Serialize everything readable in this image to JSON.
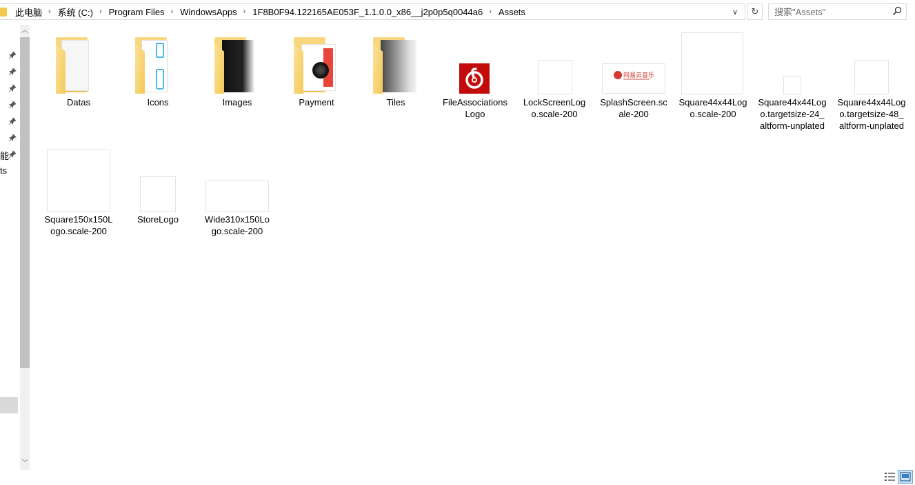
{
  "address": {
    "crumbs": [
      "此电脑",
      "系统 (C:)",
      "Program Files",
      "WindowsApps",
      "1F8B0F94.122165AE053F_1.1.0.0_x86__j2p0p5q0044a6",
      "Assets"
    ],
    "separator": "›",
    "dropdown_glyph": "∨",
    "refresh_glyph": "↻"
  },
  "search": {
    "placeholder": "搜索\"Assets\""
  },
  "nav": {
    "label_1": "能",
    "label_2": "ts"
  },
  "items": [
    {
      "label": "Datas",
      "kind": "folder"
    },
    {
      "label": "Icons",
      "kind": "folder"
    },
    {
      "label": "Images",
      "kind": "folder"
    },
    {
      "label": "Payment",
      "kind": "folder"
    },
    {
      "label": "Tiles",
      "kind": "folder"
    },
    {
      "label": "FileAssociationsLogo",
      "kind": "image"
    },
    {
      "label": "LockScreenLogo.scale-200",
      "kind": "image"
    },
    {
      "label": "SplashScreen.scale-200",
      "kind": "image"
    },
    {
      "label": "Square44x44Logo.scale-200",
      "kind": "image"
    },
    {
      "label": "Square44x44Logo.targetsize-24_altform-unplated",
      "kind": "image"
    },
    {
      "label": "Square44x44Logo.targetsize-48_altform-unplated",
      "kind": "image"
    },
    {
      "label": "Square150x150Logo.scale-200",
      "kind": "image"
    },
    {
      "label": "StoreLogo",
      "kind": "image"
    },
    {
      "label": "Wide310x150Logo.scale-200",
      "kind": "image"
    }
  ],
  "splash_brand_text": "网易云音乐",
  "colors": {
    "brand_red": "#c20c0c",
    "folder_yellow": "#f3ca5a",
    "selection_blue": "#cce4f7"
  }
}
